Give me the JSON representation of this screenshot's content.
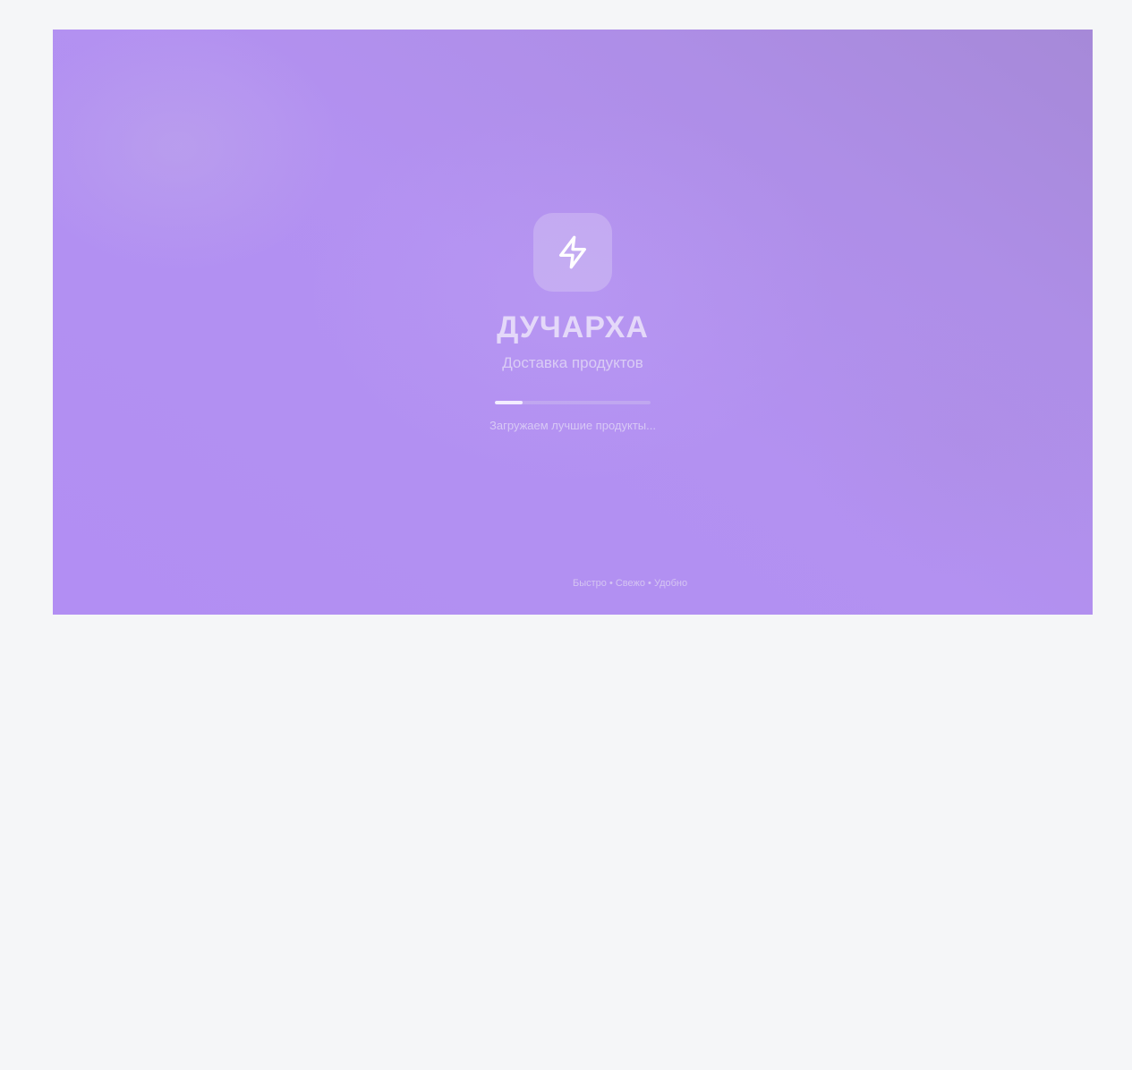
{
  "splash": {
    "logo_icon": "lightning-bolt-icon",
    "brand_name": "ДУЧАРХА",
    "tagline": "Доставка продуктов",
    "progress": 0.18,
    "loading_text": "Загружаем лучшие продукты...",
    "footer_text": "Быстро • Свежо • Удобно"
  },
  "colors": {
    "page_background": "#f5f6f8",
    "gradient_start": "#b28ef3",
    "gradient_end": "#a689d8",
    "accent_white": "#ffffff"
  }
}
